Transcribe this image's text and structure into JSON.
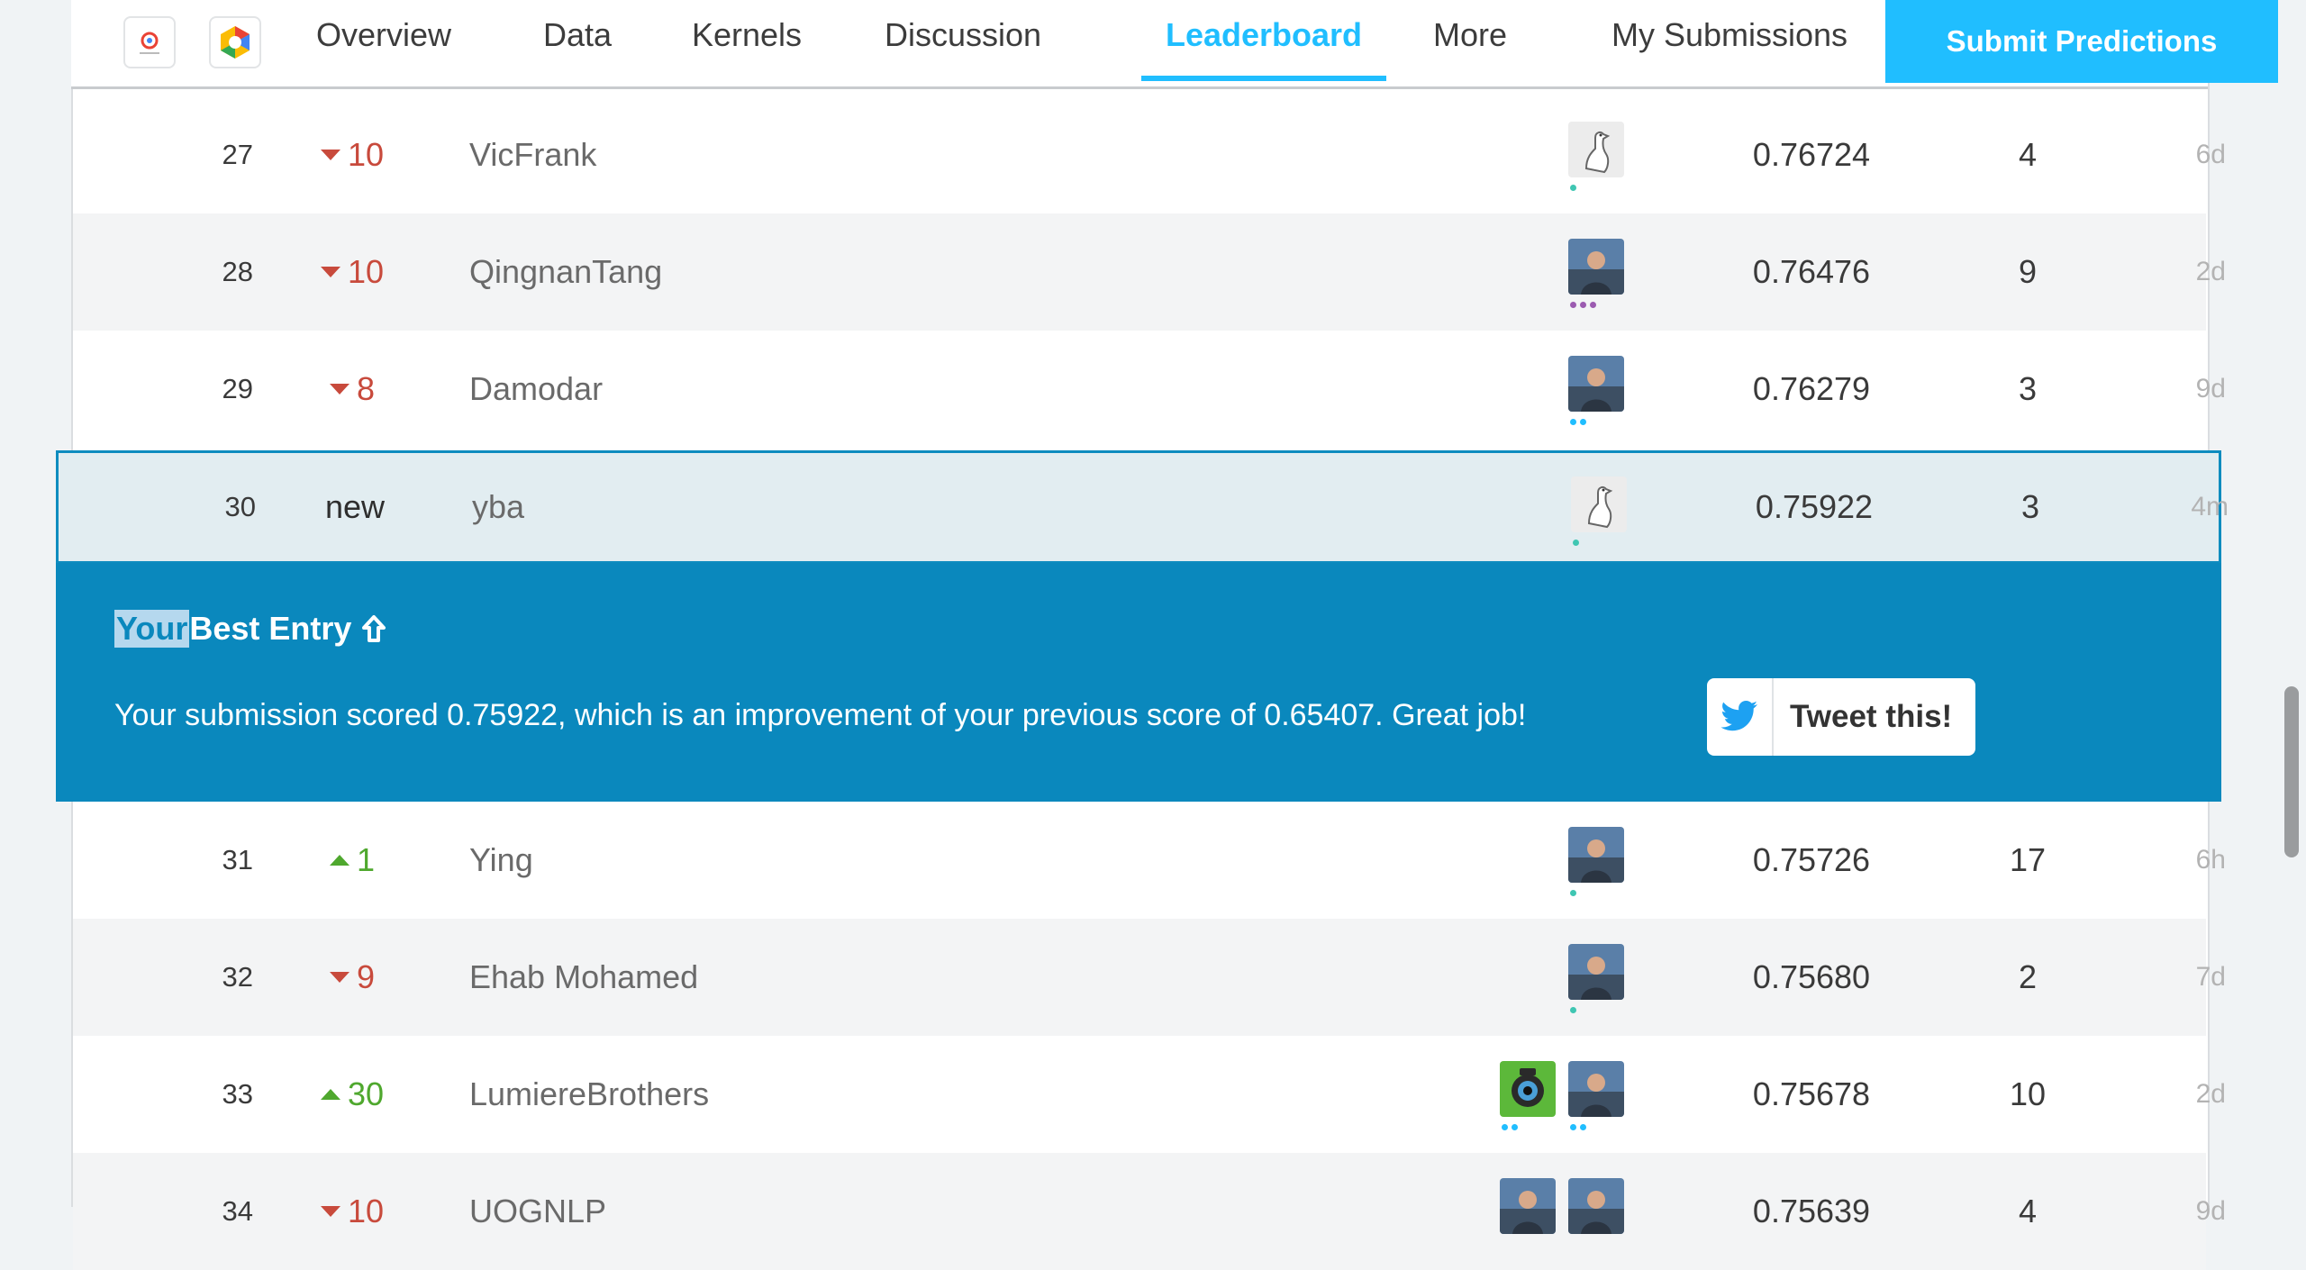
{
  "nav": {
    "tabs": [
      {
        "label": "Overview",
        "active": false
      },
      {
        "label": "Data",
        "active": false
      },
      {
        "label": "Kernels",
        "active": false
      },
      {
        "label": "Discussion",
        "active": false
      },
      {
        "label": "Leaderboard",
        "active": true
      },
      {
        "label": "More",
        "active": false
      },
      {
        "label": "My Submissions",
        "active": false
      }
    ],
    "submit_label": "Submit Predictions"
  },
  "rows": [
    {
      "rank": "27",
      "change": "10",
      "direction": "down",
      "team": "VicFrank",
      "score": "0.76724",
      "entries": "4",
      "last": "6d",
      "avatars": [
        "goose-avatar"
      ],
      "dots": 1,
      "dot_color": "#3fc6b2"
    },
    {
      "rank": "28",
      "change": "10",
      "direction": "down",
      "team": "QingnanTang",
      "score": "0.76476",
      "entries": "9",
      "last": "2d",
      "avatars": [
        "photo-avatar"
      ],
      "dots": 3,
      "dot_color": "#9b5bb0"
    },
    {
      "rank": "29",
      "change": "8",
      "direction": "down",
      "team": "Damodar",
      "score": "0.76279",
      "entries": "3",
      "last": "9d",
      "avatars": [
        "photo-avatar"
      ],
      "dots": 2,
      "dot_color": "#20beff"
    },
    {
      "rank": "30",
      "change": "new",
      "direction": "new",
      "team": "yba",
      "score": "0.75922",
      "entries": "3",
      "last": "4m",
      "avatars": [
        "goose-avatar"
      ],
      "dots": 1,
      "dot_color": "#3fc6b2"
    },
    {
      "rank": "31",
      "change": "1",
      "direction": "up",
      "team": "Ying",
      "score": "0.75726",
      "entries": "17",
      "last": "6h",
      "avatars": [
        "photo-avatar"
      ],
      "dots": 1,
      "dot_color": "#3fc6b2"
    },
    {
      "rank": "32",
      "change": "9",
      "direction": "down",
      "team": "Ehab Mohamed",
      "score": "0.75680",
      "entries": "2",
      "last": "7d",
      "avatars": [
        "photo-avatar"
      ],
      "dots": 1,
      "dot_color": "#3fc6b2"
    },
    {
      "rank": "33",
      "change": "30",
      "direction": "up",
      "team": "LumiereBrothers",
      "score": "0.75678",
      "entries": "10",
      "last": "2d",
      "avatars": [
        "camera-avatar",
        "photo-avatar"
      ],
      "dots": 2,
      "dot_color": "#20beff"
    },
    {
      "rank": "34",
      "change": "10",
      "direction": "down",
      "team": "UOGNLP",
      "score": "0.75639",
      "entries": "4",
      "last": "9d",
      "avatars": [
        "photo-avatar",
        "photo-avatar"
      ],
      "dots": 0,
      "dot_color": "#3fc6b2"
    }
  ],
  "banner": {
    "title_highlight": "Your",
    "title_rest": " Best Entry",
    "message": "Your submission scored 0.75922, which is an improvement of your previous score of 0.65407. Great job!",
    "tweet_label": "Tweet this!"
  },
  "colors": {
    "accent": "#20beff",
    "banner": "#0a88bd",
    "down": "#c84a3c",
    "up": "#4fa82e"
  }
}
